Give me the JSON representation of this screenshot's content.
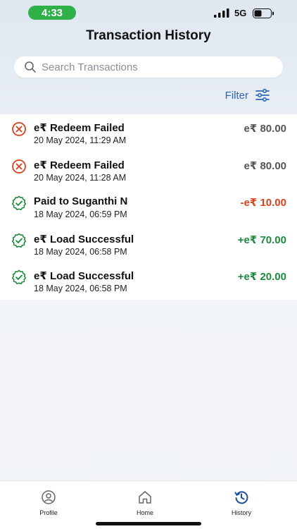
{
  "status_bar": {
    "time": "4:33",
    "network": "5G",
    "time_pill_color": "#2fb14a"
  },
  "header": {
    "title": "Transaction History"
  },
  "search": {
    "placeholder": "Search Transactions"
  },
  "filter": {
    "label": "Filter",
    "icon": "sliders-icon",
    "color": "#2c68b8"
  },
  "colors": {
    "failed": "#d9411f",
    "success": "#1e8a3f",
    "neutral": "#555555"
  },
  "transactions": [
    {
      "title": "e₹ Redeem Failed",
      "date": "20 May 2024, 11:29 AM",
      "amount": "e₹ 80.00",
      "status": "failed",
      "icon": "failed-x-icon"
    },
    {
      "title": "e₹ Redeem Failed",
      "date": "20 May 2024, 11:28 AM",
      "amount": "e₹ 80.00",
      "status": "failed",
      "icon": "failed-x-icon"
    },
    {
      "title": "Paid to Suganthi N",
      "date": "18 May 2024, 06:59 PM",
      "amount": "-e₹ 10.00",
      "status": "debit",
      "icon": "success-badge-icon"
    },
    {
      "title": "e₹ Load Successful",
      "date": "18 May 2024, 06:58 PM",
      "amount": "+e₹ 70.00",
      "status": "credit",
      "icon": "success-badge-icon"
    },
    {
      "title": "e₹ Load Successful",
      "date": "18 May 2024, 06:58 PM",
      "amount": "+e₹ 20.00",
      "status": "credit",
      "icon": "success-badge-icon"
    }
  ],
  "nav": [
    {
      "label": "Profile",
      "icon": "profile-icon"
    },
    {
      "label": "Home",
      "icon": "home-icon"
    },
    {
      "label": "History",
      "icon": "history-icon",
      "active": true
    }
  ]
}
